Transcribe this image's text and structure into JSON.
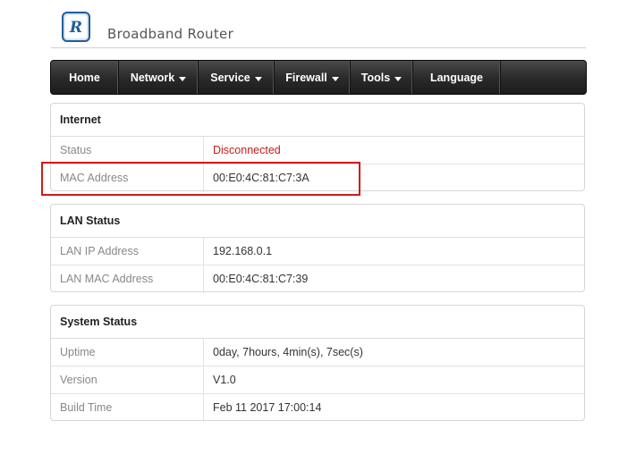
{
  "header": {
    "logo_letter": "R",
    "brand": "Broadband Router"
  },
  "nav": {
    "items": [
      {
        "label": "Home",
        "has_dropdown": false
      },
      {
        "label": "Network",
        "has_dropdown": true
      },
      {
        "label": "Service",
        "has_dropdown": true
      },
      {
        "label": "Firewall",
        "has_dropdown": true
      },
      {
        "label": "Tools",
        "has_dropdown": true
      },
      {
        "label": "Language",
        "has_dropdown": false
      }
    ]
  },
  "panels": {
    "internet": {
      "title": "Internet",
      "rows": [
        {
          "label": "Status",
          "value": "Disconnected"
        },
        {
          "label": "MAC Address",
          "value": "00:E0:4C:81:C7:3A"
        }
      ]
    },
    "lan": {
      "title": "LAN Status",
      "rows": [
        {
          "label": "LAN IP Address",
          "value": "192.168.0.1"
        },
        {
          "label": "LAN MAC Address",
          "value": "00:E0:4C:81:C7:39"
        }
      ]
    },
    "system": {
      "title": "System Status",
      "rows": [
        {
          "label": "Uptime",
          "value": "0day, 7hours, 4min(s), 7sec(s)"
        },
        {
          "label": "Version",
          "value": "V1.0"
        },
        {
          "label": "Build Time",
          "value": "Feb 11 2017 17:00:14"
        }
      ]
    }
  },
  "colors": {
    "status_alert": "#cc1a1a",
    "highlight": "#d11a1a",
    "nav_bg": "#2b2b2b"
  }
}
